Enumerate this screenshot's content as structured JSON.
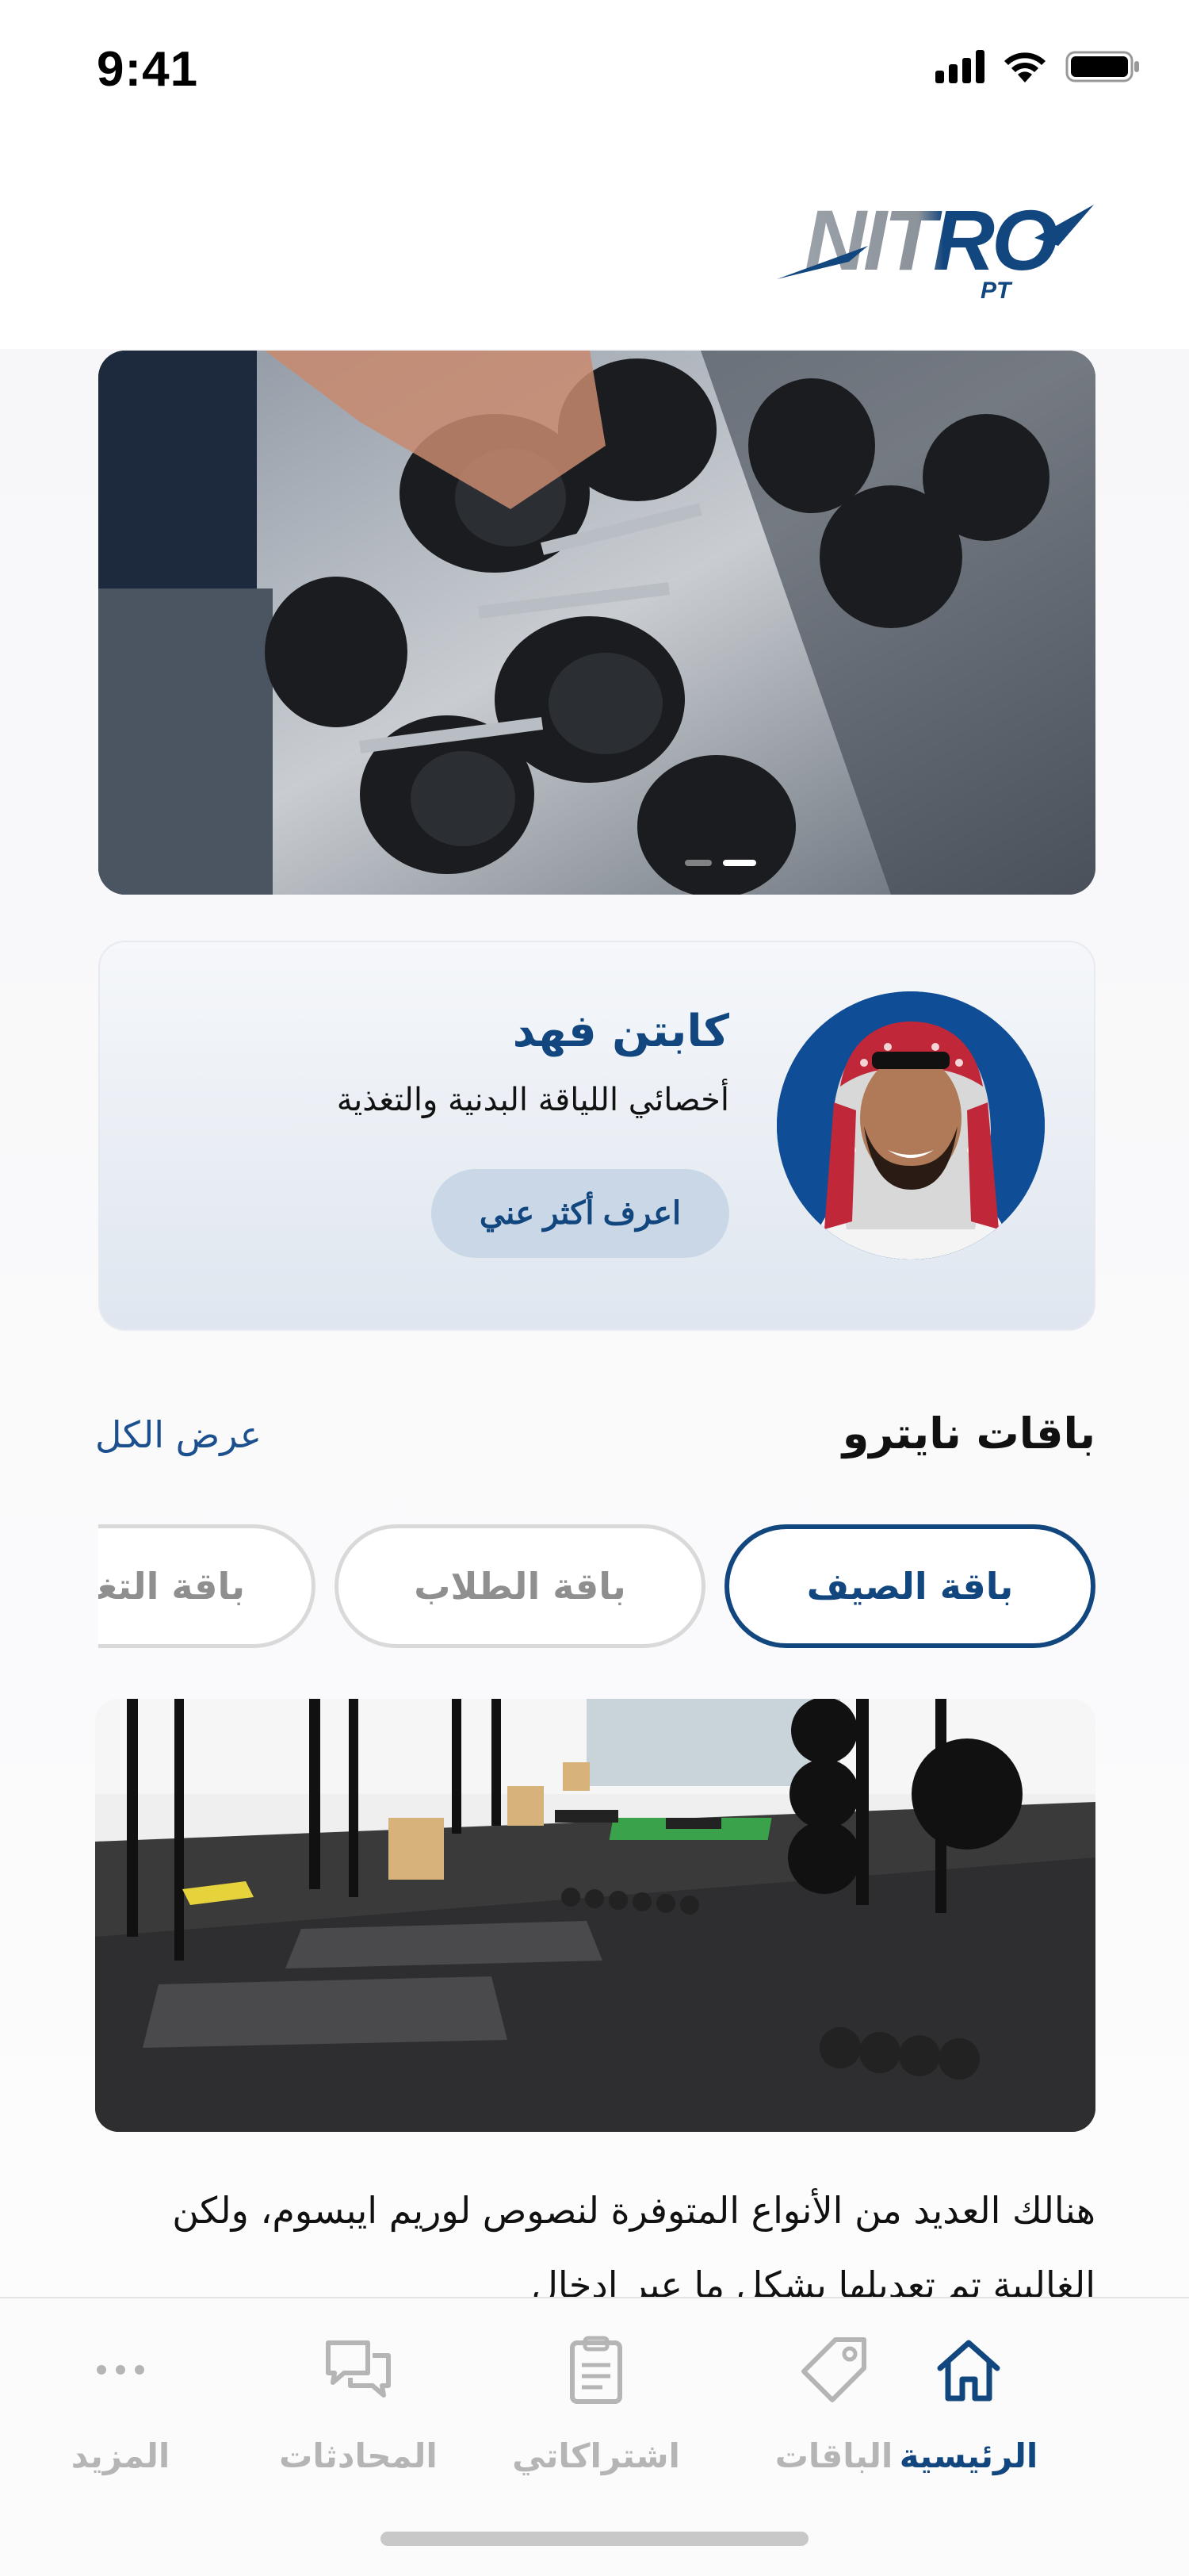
{
  "status_bar": {
    "time": "9:41"
  },
  "logo": {
    "text": "NITRO",
    "sub": "PT"
  },
  "coach": {
    "name": "كابتن فهد",
    "title": "أخصائي اللياقة البدنية والتغذية",
    "button": "اعرف أكثر عني"
  },
  "packages": {
    "title": "باقات نايترو",
    "view_all": "عرض الكل",
    "chips": [
      "باقة الصيف",
      "باقة الطلاب",
      "باقة التغذ"
    ]
  },
  "description": "هنالك العديد من الأنواع المتوفرة لنصوص لوريم ايبسوم، ولكن الغالبية تم تعديلها بشكل ما عبر إدخال",
  "nav": {
    "items": [
      {
        "label": "الرئيسية",
        "icon": "home-icon",
        "active": true
      },
      {
        "label": "الباقات",
        "icon": "tag-icon",
        "active": false
      },
      {
        "label": "اشتراكاتي",
        "icon": "clipboard-icon",
        "active": false
      },
      {
        "label": "المحادثات",
        "icon": "chat-icon",
        "active": false
      },
      {
        "label": "المزيد",
        "icon": "more-icon",
        "active": false
      }
    ]
  },
  "colors": {
    "primary": "#12467f",
    "inactive": "#b5b5b5",
    "chip_border": "#d9d9d9"
  }
}
